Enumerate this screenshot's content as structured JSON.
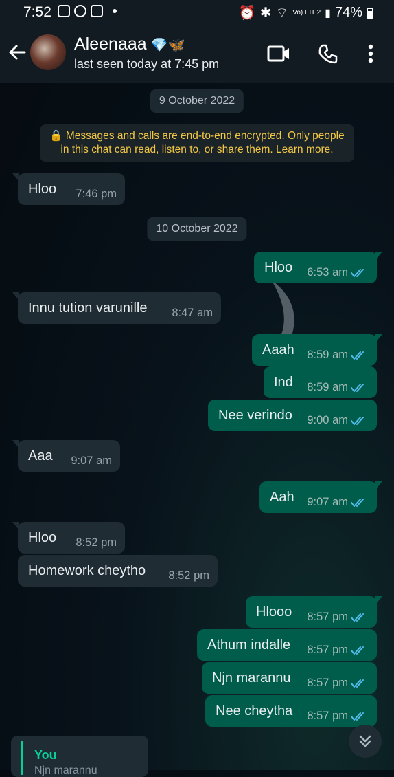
{
  "status_bar": {
    "time": "7:52",
    "network": "Vo) LTE2",
    "battery": "74%"
  },
  "header": {
    "contact_name": "Aleenaaa",
    "contact_emoji": "💎🦋",
    "last_seen": "last seen today at 7:45 pm"
  },
  "dates": [
    "9 October 2022",
    "10 October 2022"
  ],
  "encryption_notice": {
    "line1": "🔒 Messages and calls are end-to-end encrypted. Only people",
    "line2": "in this chat can read, listen to, or share them. Learn more."
  },
  "messages": [
    {
      "text": "Hloo",
      "time": "7:46 pm",
      "dir": "in"
    },
    {
      "text": "Hloo",
      "time": "6:53 am",
      "dir": "out"
    },
    {
      "text": "Innu tution varunille",
      "time": "8:47 am",
      "dir": "in"
    },
    {
      "text": "Aaah",
      "time": "8:59 am",
      "dir": "out"
    },
    {
      "text": "Ind",
      "time": "8:59 am",
      "dir": "out"
    },
    {
      "text": "Nee verindo",
      "time": "9:00 am",
      "dir": "out"
    },
    {
      "text": "Aaa",
      "time": "9:07 am",
      "dir": "in"
    },
    {
      "text": "Aah",
      "time": "9:07 am",
      "dir": "out"
    },
    {
      "text": "Hloo",
      "time": "8:52 pm",
      "dir": "in"
    },
    {
      "text": "Homework cheytho",
      "time": "8:52 pm",
      "dir": "in"
    },
    {
      "text": "Hlooo",
      "time": "8:57 pm",
      "dir": "out"
    },
    {
      "text": "Athum indalle",
      "time": "8:57 pm",
      "dir": "out"
    },
    {
      "text": "Njn marannu",
      "time": "8:57 pm",
      "dir": "out"
    },
    {
      "text": "Nee cheytha",
      "time": "8:57 pm",
      "dir": "out"
    }
  ],
  "reply_preview": {
    "author": "You",
    "text": "Njn marannu"
  },
  "colors": {
    "incoming": "#1f2c33",
    "outgoing": "#005c4b",
    "read_ticks": "#53bdeb",
    "accent": "#06cf9c"
  }
}
